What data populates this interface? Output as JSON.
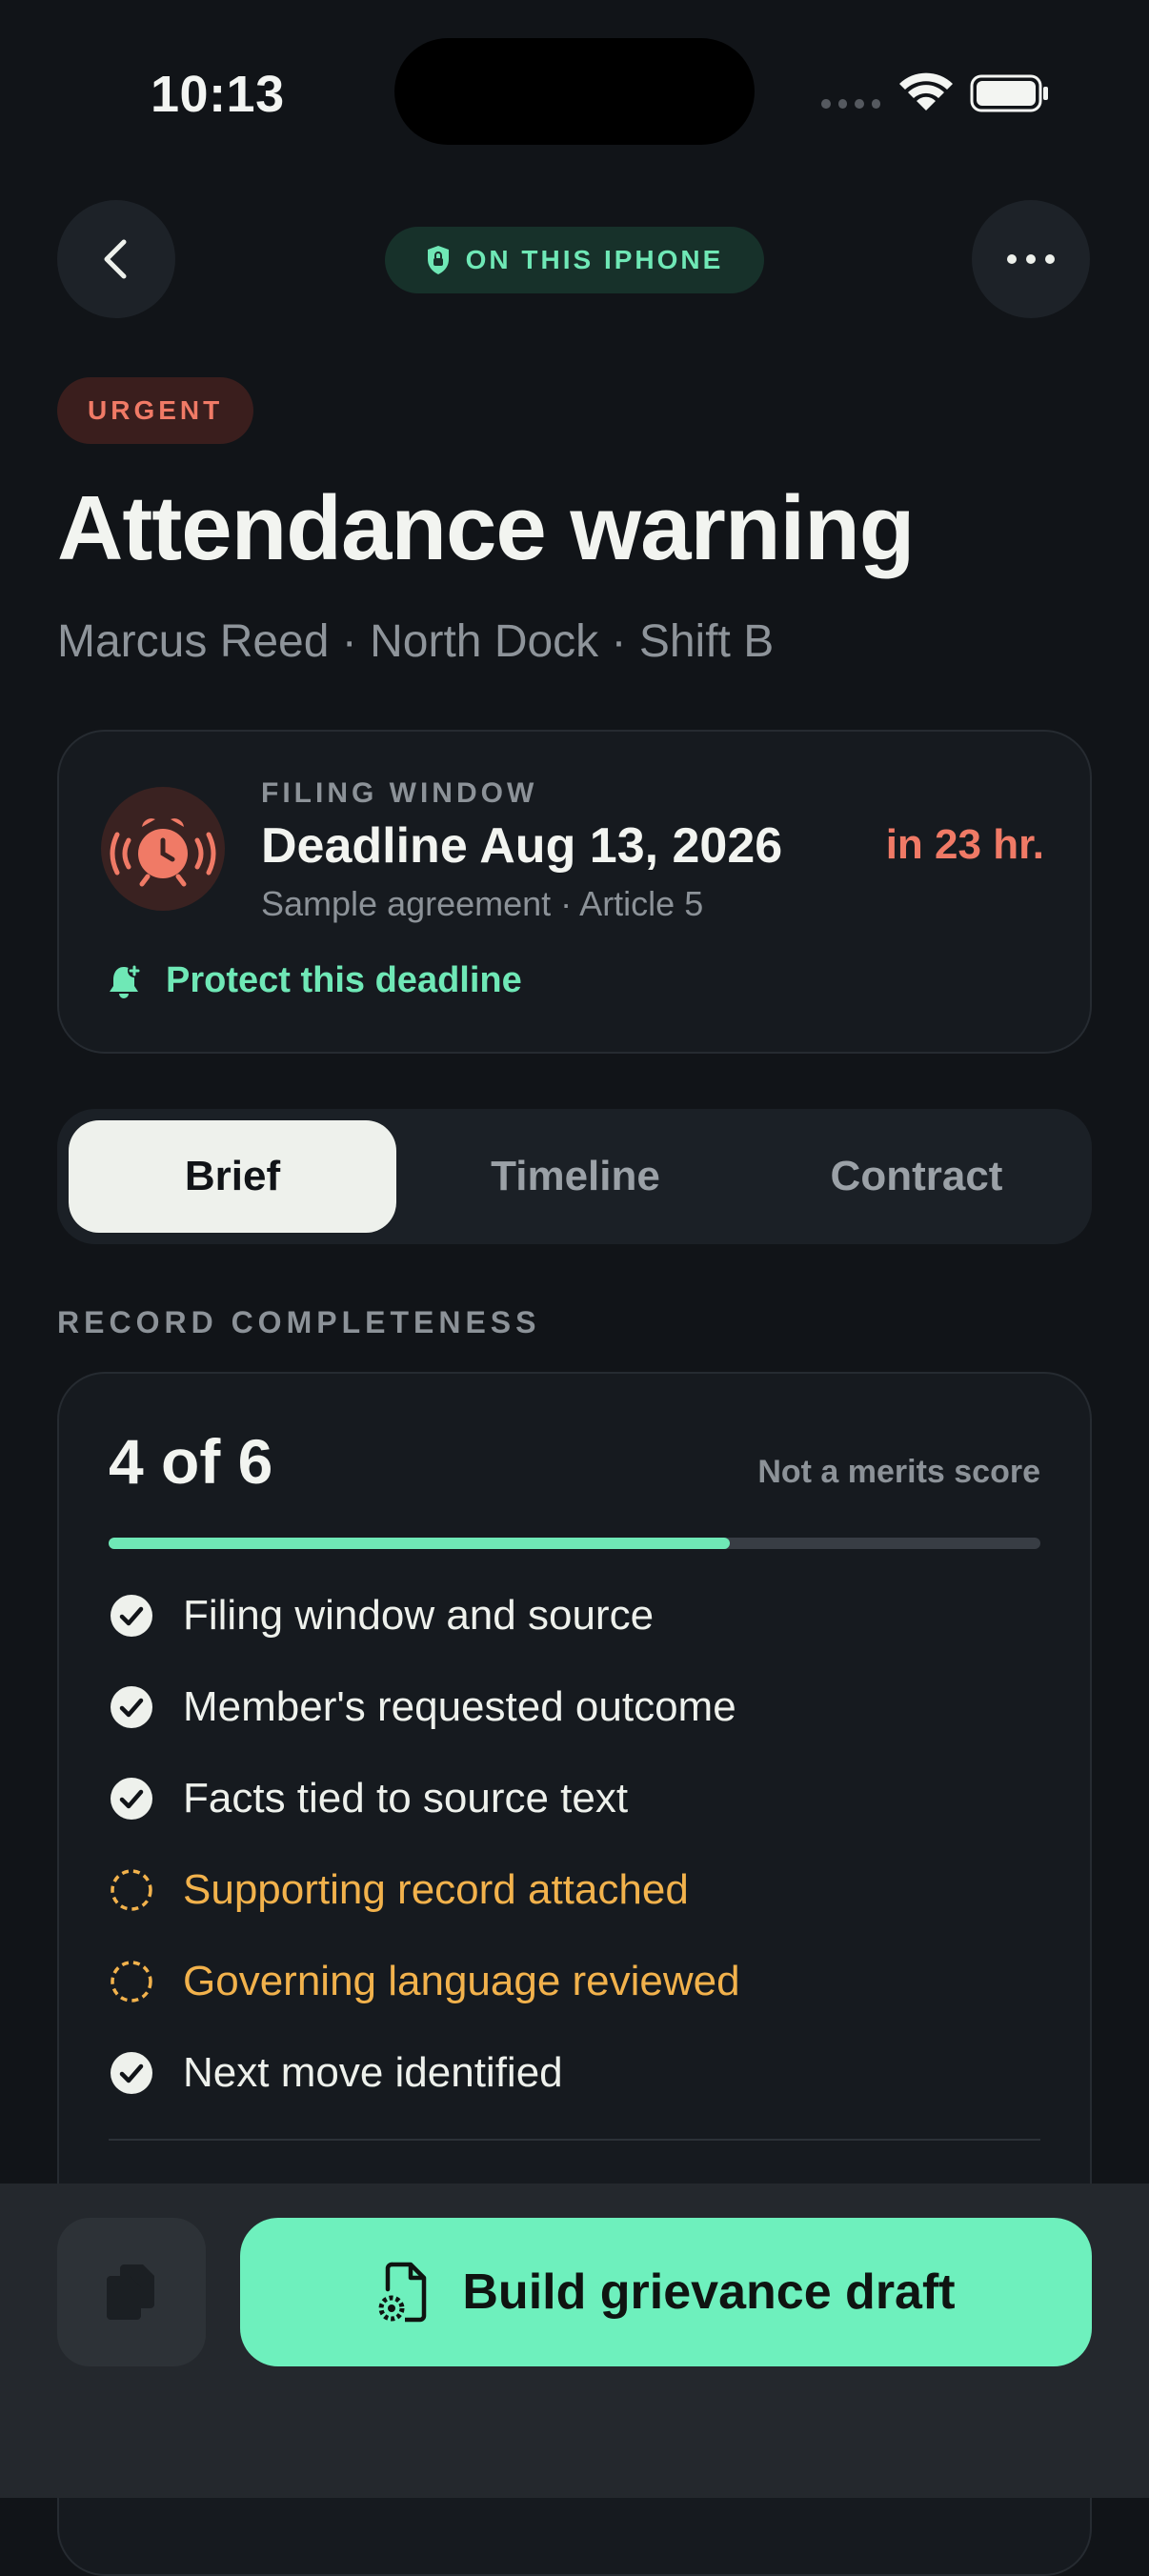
{
  "status_bar": {
    "time": "10:13"
  },
  "header": {
    "back_icon": "chevron-left-icon",
    "device_label": "ON THIS IPHONE",
    "device_icon": "lock-icon",
    "more_icon": "ellipsis-icon"
  },
  "case": {
    "priority": "URGENT",
    "title": "Attendance warning",
    "subtitle": "Marcus Reed · North Dock · Shift B"
  },
  "filing_window": {
    "label": "FILING WINDOW",
    "deadline": "Deadline Aug 13, 2026",
    "source": "Sample agreement · Article 5",
    "remaining": "in 23 hr.",
    "protect_label": "Protect this deadline"
  },
  "tabs": [
    {
      "label": "Brief",
      "active": true
    },
    {
      "label": "Timeline",
      "active": false
    },
    {
      "label": "Contract",
      "active": false
    }
  ],
  "completeness": {
    "section_label": "RECORD COMPLETENESS",
    "count": "4 of 6",
    "note": "Not a merits score",
    "progress": 0.667,
    "items": [
      {
        "label": "Filing window and source",
        "done": true
      },
      {
        "label": "Member's requested outcome",
        "done": true
      },
      {
        "label": "Facts tied to source text",
        "done": true
      },
      {
        "label": "Supporting record attached",
        "done": false
      },
      {
        "label": "Governing language reviewed",
        "done": false
      },
      {
        "label": "Next move identified",
        "done": true
      }
    ]
  },
  "actions": {
    "copy_icon": "copy-icon",
    "build_label": "Build grievance draft",
    "build_icon": "document-gear-icon"
  },
  "colors": {
    "background": "#111418",
    "accent_green": "#6fe8b6",
    "urgent_red": "#f07a66",
    "pending_amber": "#f2b24c"
  }
}
